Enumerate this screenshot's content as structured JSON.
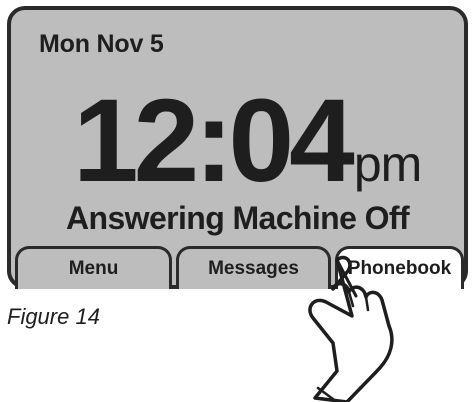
{
  "screen": {
    "date": "Mon Nov 5",
    "time": "12:04",
    "ampm": "pm",
    "status": "Answering Machine Off"
  },
  "softkeys": {
    "menu": "Menu",
    "messages": "Messages",
    "phonebook": "Phonebook"
  },
  "caption": "Figure 14",
  "icons": {
    "pointer": "pointing-hand-icon"
  },
  "colors": {
    "screen_bg": "#bdbdbd",
    "bezel": "#2a2a2a",
    "selected_key": "#ffffff"
  }
}
